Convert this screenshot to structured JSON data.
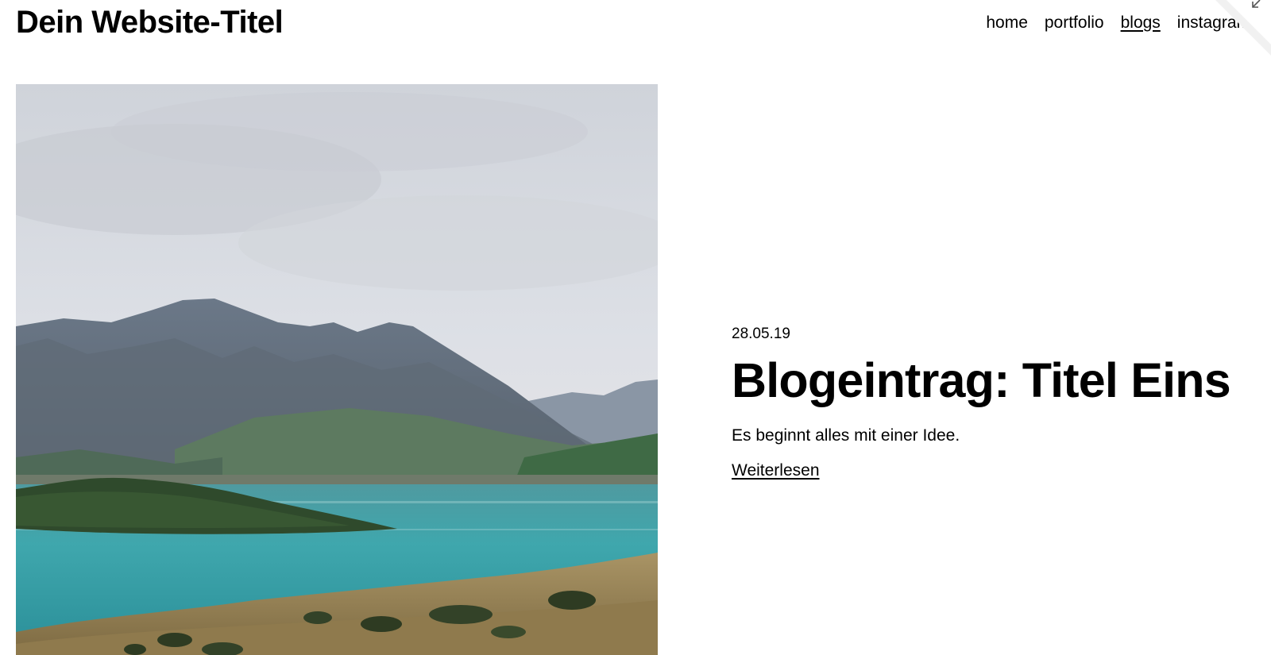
{
  "site": {
    "title": "Dein Website-Titel"
  },
  "nav": {
    "items": [
      {
        "label": "home",
        "active": false
      },
      {
        "label": "portfolio",
        "active": false
      },
      {
        "label": "blogs",
        "active": true
      },
      {
        "label": "instagram",
        "active": false
      }
    ]
  },
  "post": {
    "date": "28.05.19",
    "title": "Blogeintrag: Titel Eins",
    "excerpt": "Es beginnt alles mit einer Idee.",
    "read_more": "Weiterlesen"
  },
  "hero_image": {
    "subject": "mountain-lake-landscape"
  },
  "icons": {
    "corner": "collapse-arrow-icon"
  },
  "colors": {
    "text": "#000000",
    "background": "#ffffff"
  }
}
